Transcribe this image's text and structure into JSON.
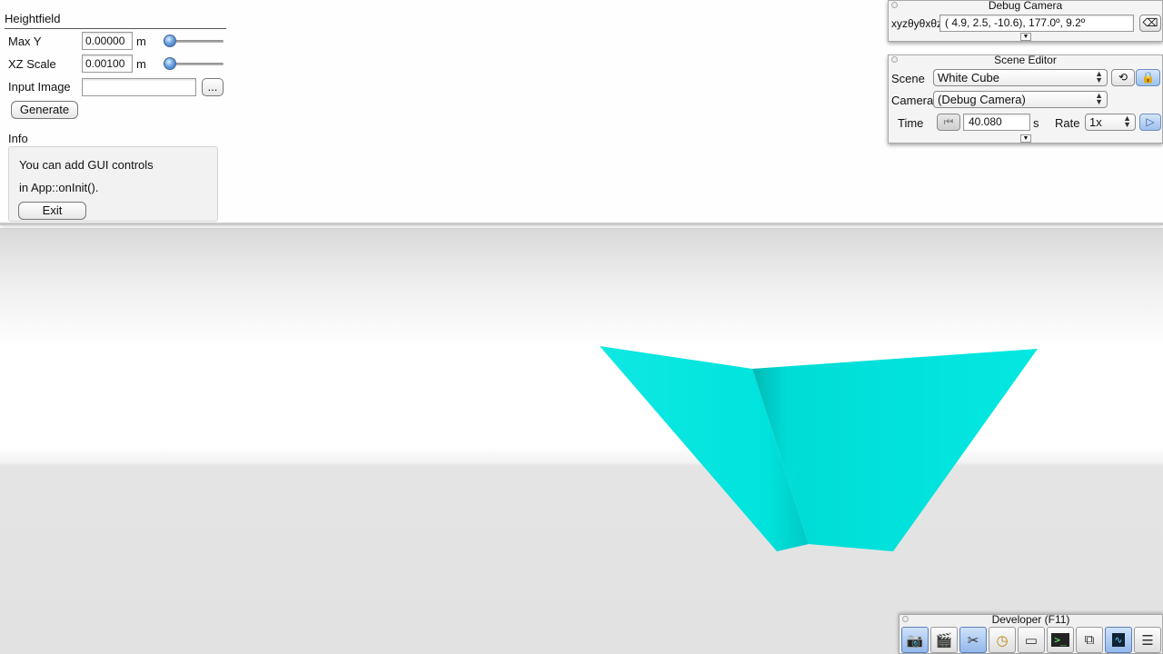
{
  "heightfield": {
    "title": "Heightfield",
    "max_y": {
      "label": "Max Y",
      "value": "0.00000",
      "unit": "m",
      "slider_fraction": 0.1
    },
    "xz_scale": {
      "label": "XZ Scale",
      "value": "0.00100",
      "unit": "m",
      "slider_fraction": 0.11
    },
    "input_image": {
      "label": "Input Image",
      "value": "",
      "browse_label": "..."
    },
    "generate_label": "Generate"
  },
  "info": {
    "title": "Info",
    "line1": "You can add GUI controls",
    "line2": "in App::onInit().",
    "exit_label": "Exit"
  },
  "debug_camera": {
    "title": "Debug Camera",
    "coord_label": "xyzθyθxθz",
    "coord_value": "(  4.9,   2.5, -10.6),  177.0º,   9.2º"
  },
  "scene_editor": {
    "title": "Scene Editor",
    "scene_label": "Scene",
    "scene_value": "White Cube",
    "camera_label": "Camera",
    "camera_value": "(Debug Camera)",
    "time_label": "Time",
    "time_value": "40.080",
    "time_unit": "s",
    "rate_label": "Rate",
    "rate_value": "1x"
  },
  "developer": {
    "title": "Developer (F11)",
    "tools": [
      "camera-icon",
      "clapperboard-icon",
      "tools-icon",
      "clock-icon",
      "new-window-icon",
      "terminal-icon",
      "windows-icon",
      "profiler-icon",
      "document-icon"
    ]
  },
  "colors": {
    "shape_cyan": "#00e6e0",
    "accent_blue": "#4a86d4"
  }
}
